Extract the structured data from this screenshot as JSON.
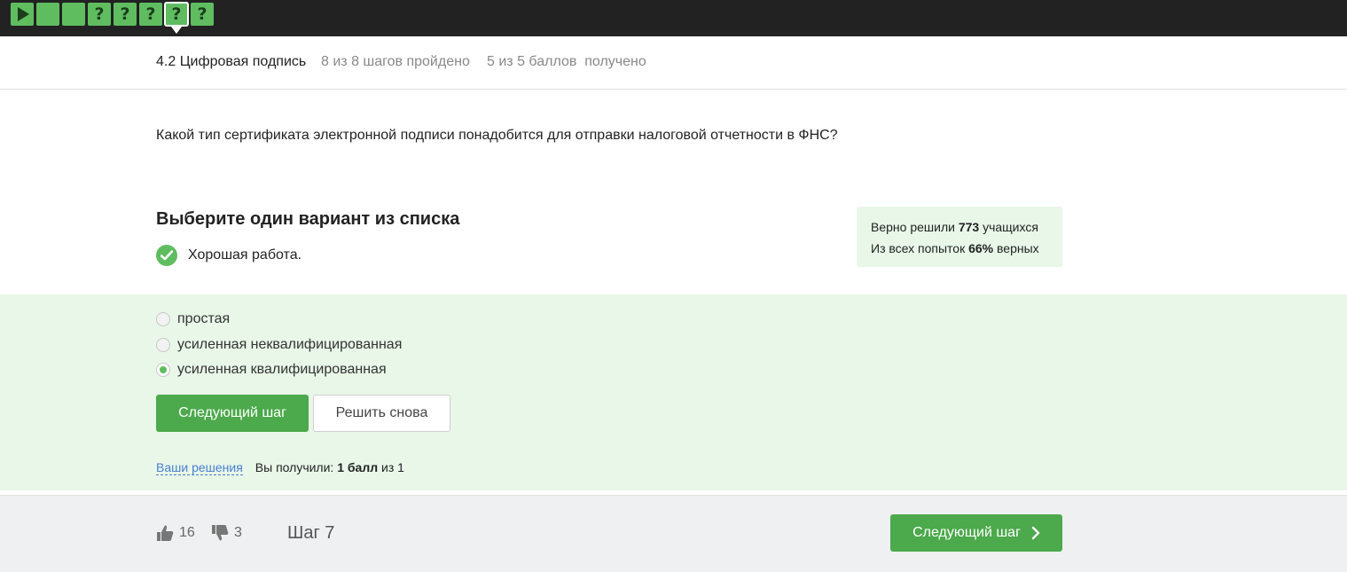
{
  "step_nav": {
    "steps": [
      {
        "type": "video",
        "icon": "play-icon",
        "label": ""
      },
      {
        "type": "text",
        "label": ""
      },
      {
        "type": "text",
        "label": ""
      },
      {
        "type": "quiz",
        "label": "?"
      },
      {
        "type": "quiz",
        "label": "?"
      },
      {
        "type": "quiz",
        "label": "?"
      },
      {
        "type": "quiz",
        "label": "?",
        "active": true
      },
      {
        "type": "quiz",
        "label": "?"
      }
    ]
  },
  "lesson": {
    "title": "4.2 Цифровая подпись",
    "progress": "8 из 8 шагов пройдено",
    "score": "5 из 5 баллов  получено"
  },
  "question": "Какой тип сертификата электронной подписи понадобится для отправки налоговой отчетности в ФНС?",
  "instruction": "Выберите один вариант из списка",
  "feedback": "Хорошая работа.",
  "stats": {
    "line1_prefix": "Верно решили ",
    "line1_value": "773",
    "line1_suffix": " учащихся",
    "line2_prefix": "Из всех попыток ",
    "line2_value": "66%",
    "line2_suffix": " верных"
  },
  "options": [
    {
      "label": "простая",
      "selected": false
    },
    {
      "label": "усиленная неквалифицированная",
      "selected": false
    },
    {
      "label": "усиленная квалифицированная",
      "selected": true
    }
  ],
  "buttons": {
    "next": "Следующий шаг",
    "retry": "Решить снова"
  },
  "solutions": {
    "link": "Ваши решения",
    "prefix": "Вы получили: ",
    "points": "1 балл",
    "suffix": " из 1"
  },
  "footer": {
    "likes": "16",
    "dislikes": "3",
    "step_label": "Шаг 7",
    "next": "Следующий шаг"
  },
  "colors": {
    "accent": "#4ca94c",
    "step_green": "#5fbd60",
    "success_bg": "#e8f7e8",
    "topbar": "#222222",
    "link": "#4a7fd0"
  }
}
